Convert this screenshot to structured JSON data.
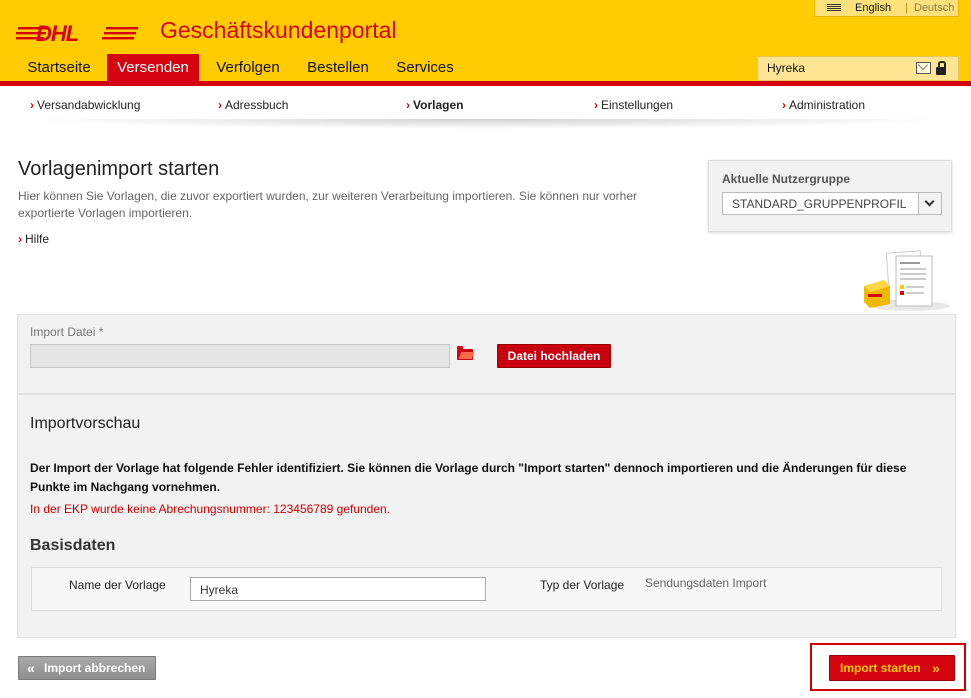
{
  "header": {
    "portal_title": "Geschäftskundenportal",
    "lang_english": "English",
    "lang_separator": "|",
    "lang_german": "Deutsch",
    "username": "Hyreka",
    "brand_colors": {
      "yellow": "#fecc00",
      "red": "#d40511"
    }
  },
  "main_nav": [
    {
      "label": "Startseite"
    },
    {
      "label": "Versenden",
      "active": true
    },
    {
      "label": "Verfolgen"
    },
    {
      "label": "Bestellen"
    },
    {
      "label": "Services"
    }
  ],
  "sub_nav": [
    {
      "label": "Versandabwicklung"
    },
    {
      "label": "Adressbuch"
    },
    {
      "label": "Vorlagen",
      "active": true
    },
    {
      "label": "Einstellungen"
    },
    {
      "label": "Administration"
    }
  ],
  "page": {
    "title": "Vorlagenimport starten",
    "description": "Hier können Sie Vorlagen, die zuvor exportiert wurden, zur weiteren Verarbeitung importieren. Sie können nur vorher exportierte Vorlagen importieren.",
    "help": "Hilfe"
  },
  "usergroup": {
    "label": "Aktuelle Nutzergruppe",
    "selected": "STANDARD_GRUPPENPROFIL"
  },
  "import_file": {
    "label": "Import Datei  *",
    "value": "",
    "upload_button": "Datei hochladen"
  },
  "preview": {
    "title": "Importvorschau",
    "warning": "Der Import der Vorlage hat folgende Fehler identifiziert. Sie können die Vorlage durch \"Import starten\" dennoch importieren und die Änderungen für diese Punkte im Nachgang vornehmen.",
    "error": "In der EKP wurde keine Abrechungsnummer: 123456789 gefunden.",
    "basis_title": "Basisdaten",
    "name_label": "Name der Vorlage",
    "name_value": "Hyreka",
    "type_label": "Typ der Vorlage",
    "type_value": "Sendungsdaten Import"
  },
  "actions": {
    "cancel": "Import abbrechen",
    "start": "Import starten"
  }
}
